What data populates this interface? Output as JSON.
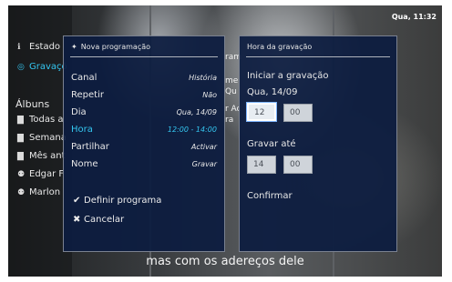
{
  "status_bar": {
    "clock": "Qua, 11:32"
  },
  "background": {
    "sidebar": {
      "items": [
        {
          "icon": "info-icon",
          "label": "Estado"
        },
        {
          "icon": "eye-icon",
          "label": "Gravaçõ"
        },
        {
          "icon": "",
          "label": "Álbuns"
        },
        {
          "icon": "folder-icon",
          "label": "Todas a"
        },
        {
          "icon": "folder-icon",
          "label": "Semana"
        },
        {
          "icon": "folder-icon",
          "label": "Mês ant"
        },
        {
          "icon": "person-icon",
          "label": "Edgar F"
        },
        {
          "icon": "person-icon",
          "label": "Marlon"
        }
      ]
    },
    "partial_texts": [
      "ram",
      "mei",
      "Qu",
      "r Ac",
      "ra"
    ],
    "subtitle": "mas com os adereços dele"
  },
  "program_dialog": {
    "title": "Nova programação",
    "rows": [
      {
        "label": "Canal",
        "value": "História"
      },
      {
        "label": "Repetir",
        "value": "Não"
      },
      {
        "label": "Dia",
        "value": "Qua, 14/09"
      },
      {
        "label": "Hora",
        "value": "12:00 - 14:00"
      },
      {
        "label": "Partilhar",
        "value": "Activar"
      },
      {
        "label": "Nome",
        "value": "Gravar"
      }
    ],
    "actions": [
      {
        "icon": "check-icon",
        "label": "Definir programa"
      },
      {
        "icon": "close-icon",
        "label": "Cancelar"
      }
    ]
  },
  "time_dialog": {
    "title": "Hora da gravação",
    "start_label": "Iniciar a gravação",
    "start_date": "Qua, 14/09",
    "start_hour": "12",
    "start_minute": "00",
    "end_label": "Gravar até",
    "end_hour": "14",
    "end_minute": "00",
    "confirm_label": "Confirmar"
  },
  "colors": {
    "accent": "#34c6f0",
    "panel_bg": "#0c1c40"
  }
}
